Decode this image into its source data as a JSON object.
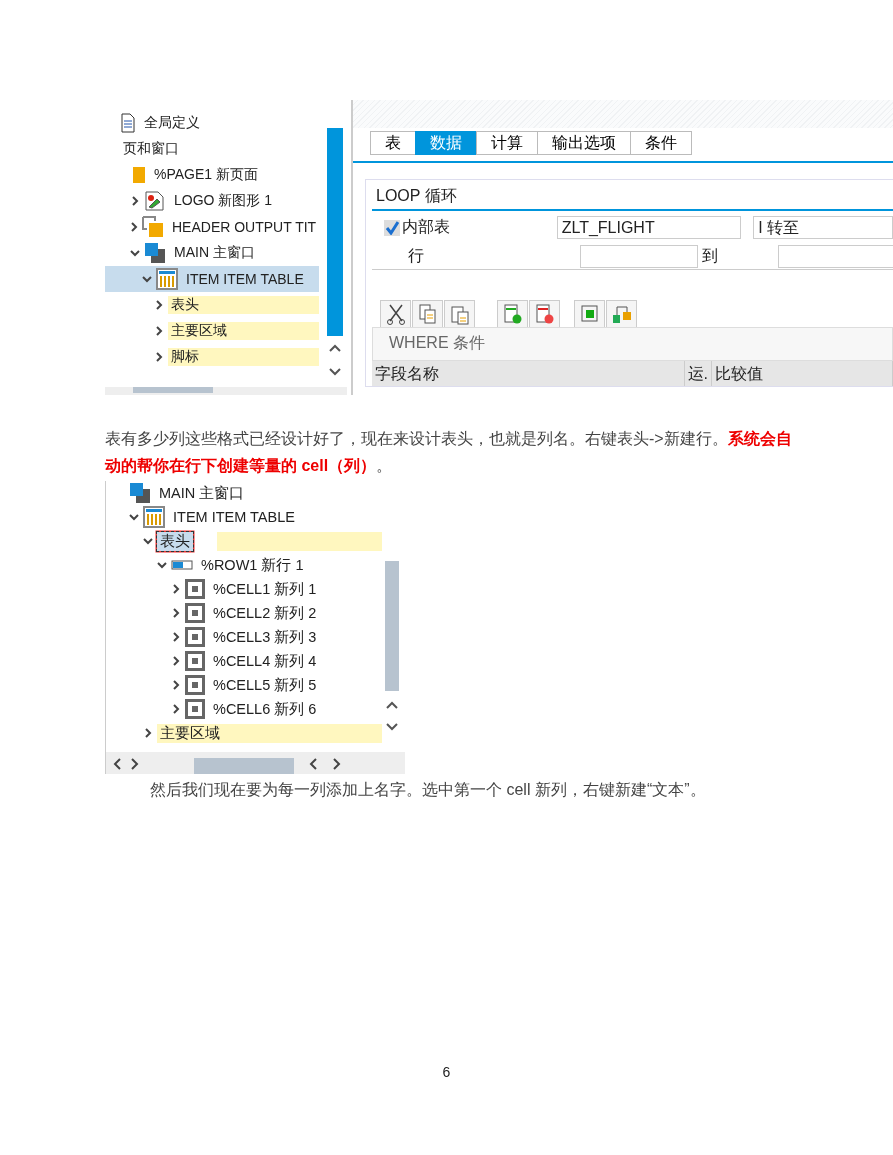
{
  "screenshot_1": {
    "tree": [
      {
        "label": "全局定义",
        "kind": "document"
      },
      {
        "label": "页和窗口",
        "children": [
          {
            "label": "%PAGE1 新页面",
            "kind": "page",
            "children": [
              {
                "label": "LOGO 新图形 1",
                "kind": "graphic",
                "expanded": false
              },
              {
                "label": "HEADER OUTPUT TIT",
                "kind": "window-orange",
                "expanded": false
              },
              {
                "label": "MAIN 主窗口",
                "kind": "window-blue",
                "expanded": true,
                "children": [
                  {
                    "label": "ITEM ITEM TABLE",
                    "kind": "table",
                    "expanded": true,
                    "selected": true,
                    "children": [
                      {
                        "label": "表头",
                        "expanded": false,
                        "highlighted": true,
                        "selected": false
                      },
                      {
                        "label": "主要区域",
                        "expanded": false,
                        "highlighted": true,
                        "selected": false
                      },
                      {
                        "label": "脚标",
                        "expanded": false,
                        "highlighted": true,
                        "selected": false
                      }
                    ]
                  }
                ]
              }
            ]
          }
        ]
      }
    ],
    "tabs": [
      {
        "label": "表",
        "selected": false
      },
      {
        "label": "数据",
        "selected": true
      },
      {
        "label": "计算",
        "selected": false
      },
      {
        "label": "输出选项",
        "selected": false
      },
      {
        "label": "条件",
        "selected": false
      }
    ],
    "loop": {
      "title": "LOOP 循环",
      "internal_table": {
        "label": "内部表",
        "checked": true,
        "value": "ZLT_FLIGHT",
        "target": "I 转至"
      },
      "rows_label": "行",
      "to_label": "到"
    },
    "where": {
      "title": "WHERE 条件",
      "columns": [
        "字段名称",
        "运.",
        "比较值"
      ]
    }
  },
  "paragraph_1": "表有多少列这些格式已经设计好了，现在来设计表头，也就是列名。右键表头->新建行。**系统会自动的帮你在行下创建等量的 cell（列）**。",
  "screenshot_2": {
    "tree": [
      {
        "label": "MAIN 主窗口",
        "kind": "window-blue",
        "children": [
          {
            "label": "ITEM ITEM TABLE",
            "kind": "table",
            "expanded": true,
            "children": [
              {
                "label": "表头",
                "expanded": true,
                "highlighted": true,
                "focused": true,
                "children": [
                  {
                    "label": "%ROW1 新行 1",
                    "kind": "row",
                    "expanded": true,
                    "children": [
                      {
                        "label": "%CELL1 新列 1",
                        "kind": "cell",
                        "expanded": false
                      },
                      {
                        "label": "%CELL2 新列 2",
                        "kind": "cell",
                        "expanded": false
                      },
                      {
                        "label": "%CELL3 新列 3",
                        "kind": "cell",
                        "expanded": false
                      },
                      {
                        "label": "%CELL4 新列 4",
                        "kind": "cell",
                        "expanded": false
                      },
                      {
                        "label": "%CELL5 新列 5",
                        "kind": "cell",
                        "expanded": false
                      },
                      {
                        "label": "%CELL6 新列 6",
                        "kind": "cell",
                        "expanded": false
                      }
                    ]
                  }
                ]
              },
              {
                "label": "主要区域",
                "expanded": false,
                "highlighted": true
              }
            ]
          }
        ]
      }
    ]
  },
  "paragraph_2": "然后我们现在要为每一列添加上名字。选中第一个 cell 新列，右键新建“文本”。",
  "page_number": "6"
}
